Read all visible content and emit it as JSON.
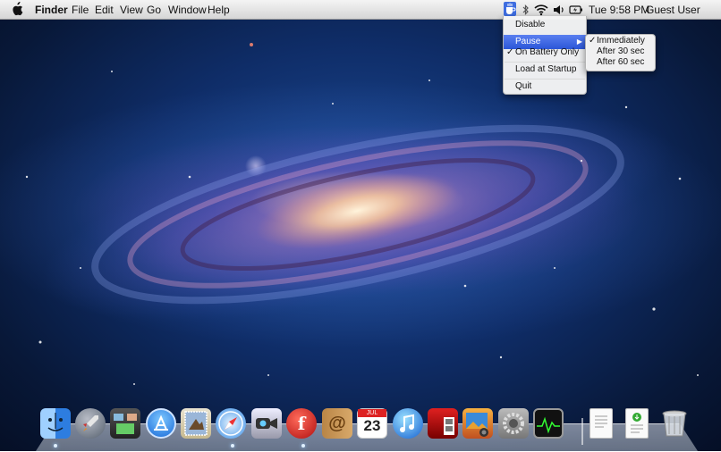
{
  "menubar": {
    "app_name": "Finder",
    "menus": [
      "File",
      "Edit",
      "View",
      "Go",
      "Window",
      "Help"
    ],
    "clock": "Tue 9:58 PM",
    "user": "Guest User"
  },
  "status_menu": {
    "items": {
      "disable": "Disable",
      "pause": "Pause",
      "on_battery_only": "On Battery Only",
      "load_at_startup": "Load at Startup",
      "quit": "Quit"
    },
    "check_mark": "✓",
    "submenu_arrow": "▶",
    "submenu": {
      "immediately": "Immediately",
      "after_30": "After 30 sec",
      "after_60": "After 60 sec"
    }
  },
  "dock": {
    "calendar_day": "23",
    "calendar_month": "JUL",
    "facebook_letter": "f"
  },
  "colors": {
    "highlight": "#3562dc",
    "desktop_deep": "#081838"
  }
}
